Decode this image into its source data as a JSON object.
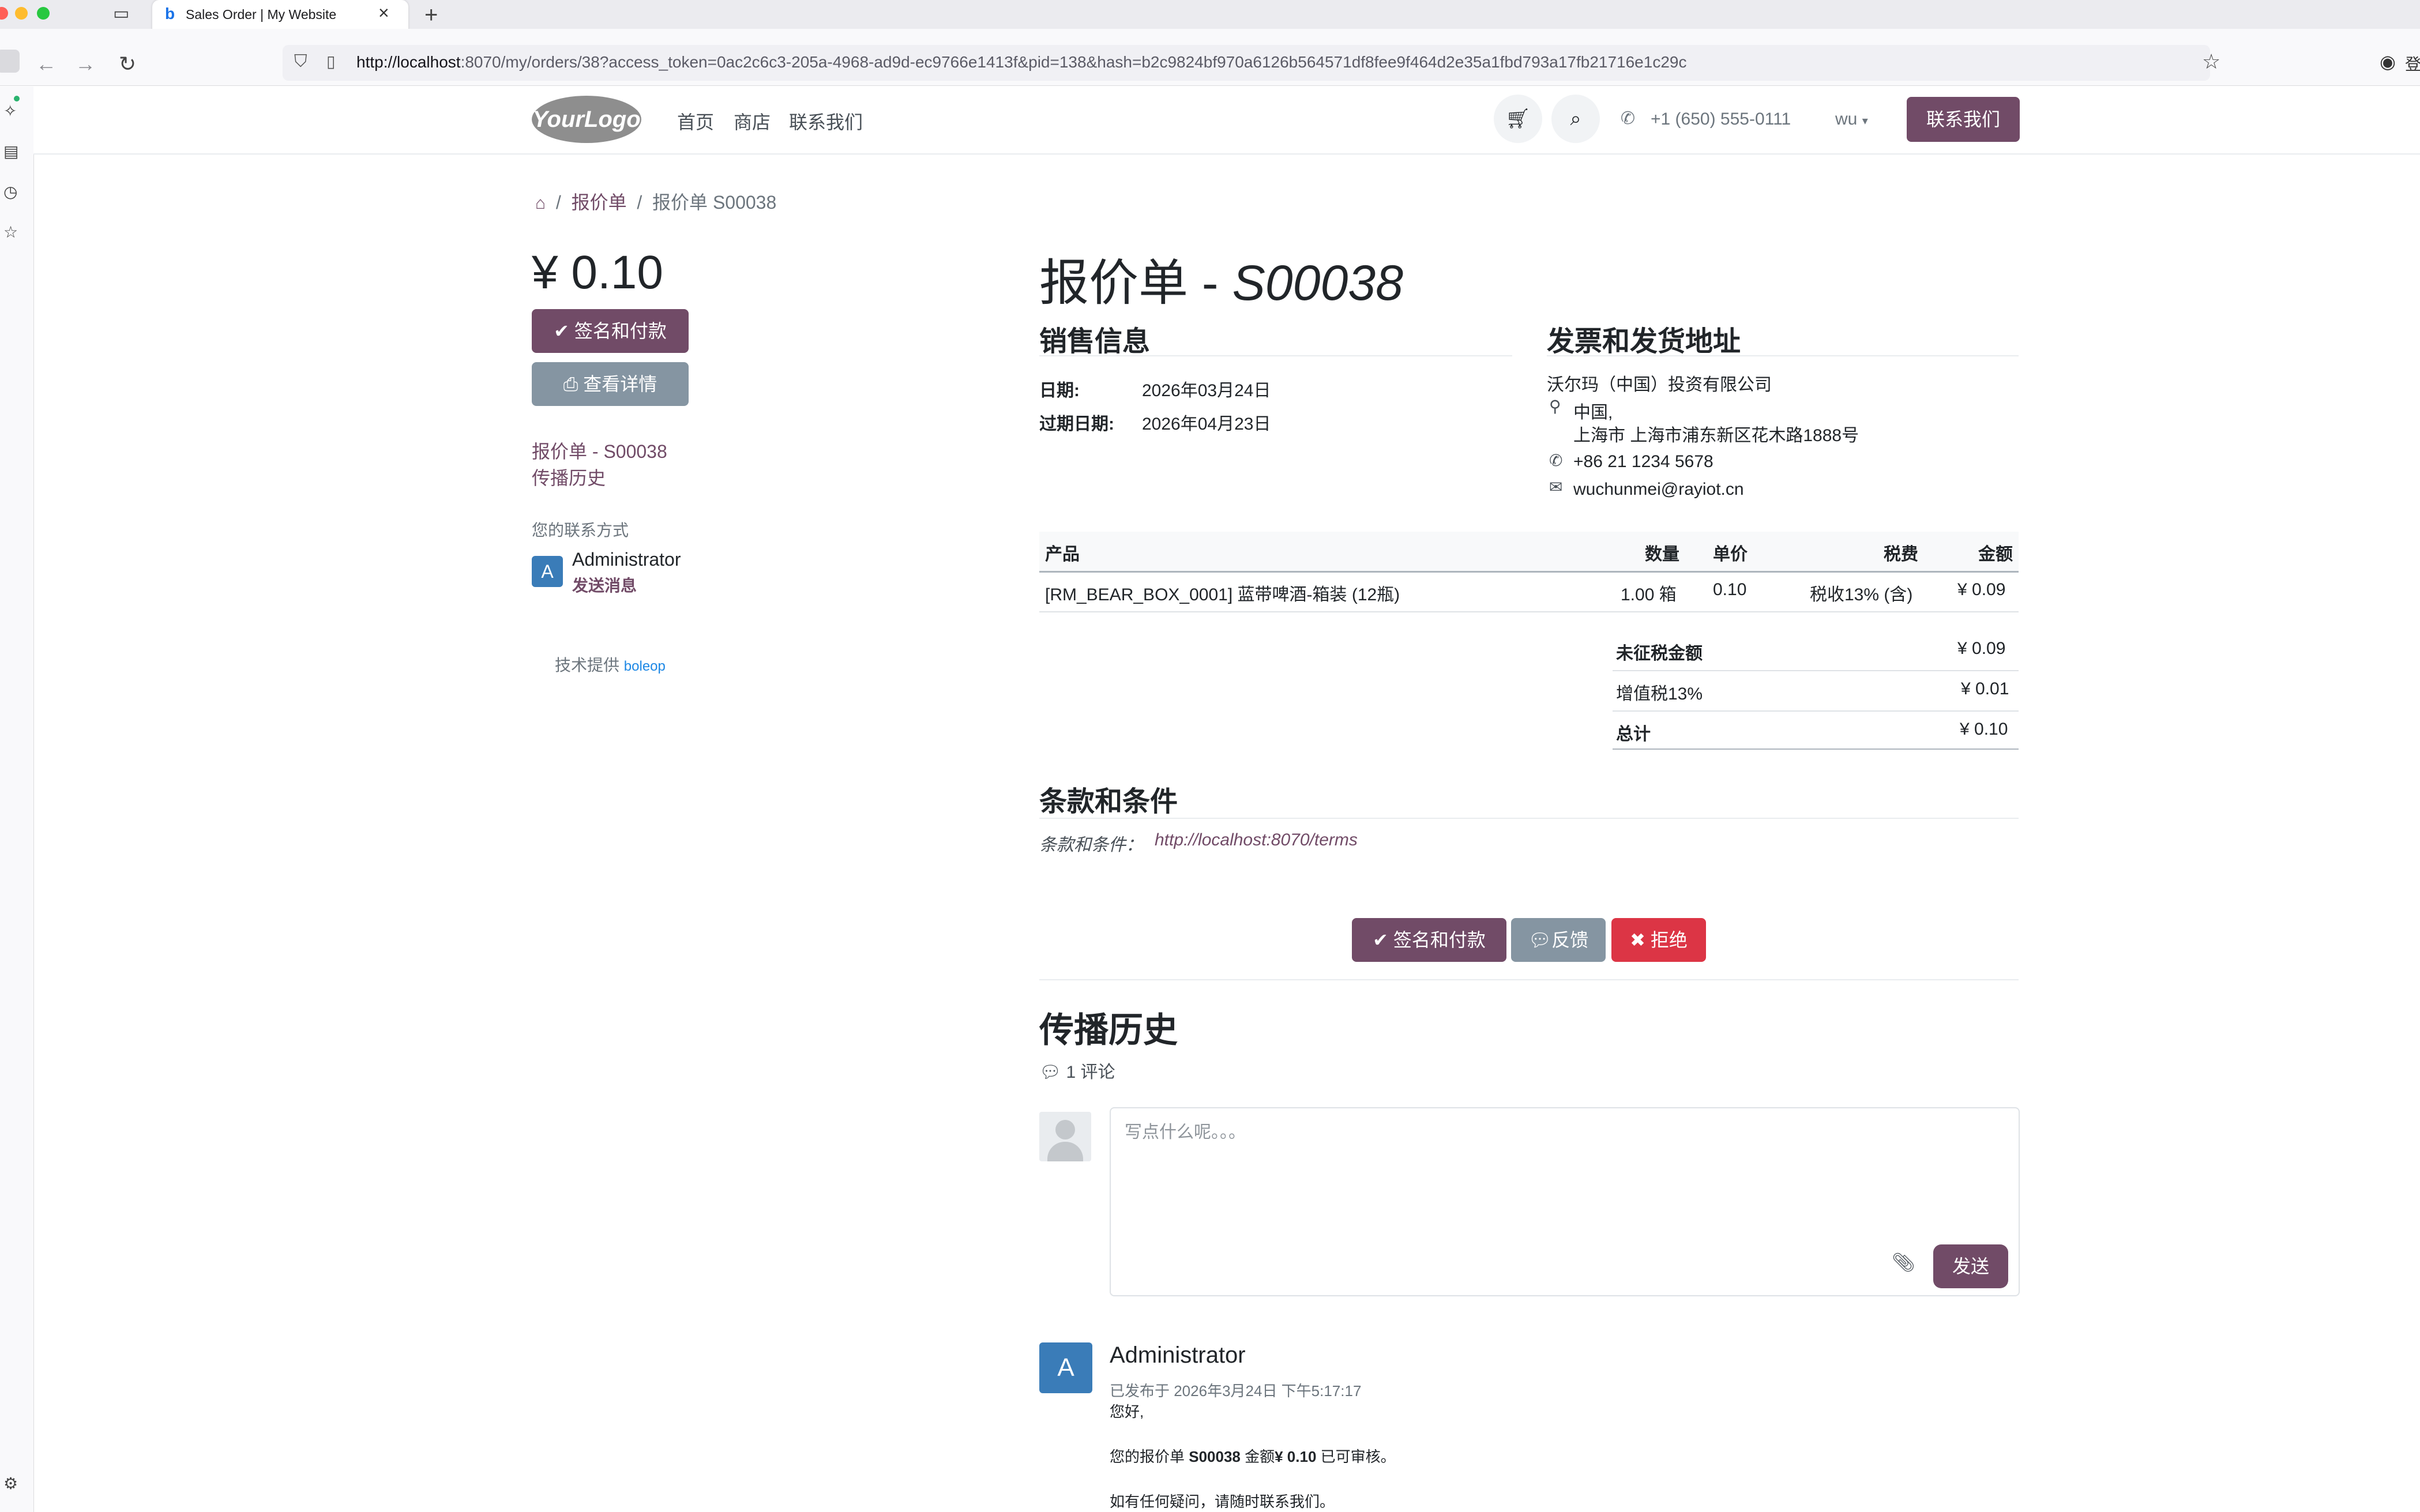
{
  "browser": {
    "tab_title": "Sales Order | My Website",
    "url_host": "http://localhost",
    "url_rest": ":8070/my/orders/38?access_token=0ac2c6c3-205a-4968-ad9d-ec9766e1413f&pid=138&hash=b2c9824bf970a6126b564571df8fee9f464d2e35a1fbd793a17fb21716e1c29c",
    "right_edge_text": "登"
  },
  "header": {
    "logo": "YourLogo",
    "nav": [
      "首页",
      "商店",
      "联系我们"
    ],
    "phone": "+1 (650) 555-0111",
    "user": "wu",
    "contact_button": "联系我们"
  },
  "breadcrumb": {
    "items": [
      "报价单",
      "报价单 S00038"
    ]
  },
  "sidebar_left": {
    "price": "¥ 0.10",
    "sign_pay_button": "签名和付款",
    "view_details_button": "查看详情",
    "nav_links": [
      "报价单 - S00038",
      "传播历史"
    ],
    "contact_label": "您的联系方式",
    "contact_name": "Administrator",
    "contact_avatar": "A",
    "send_message": "发送消息",
    "powered_by": "技术提供",
    "powered_brand": "boleop"
  },
  "main": {
    "title_prefix": "报价单 - ",
    "title_number": "S00038",
    "sales_info": {
      "heading": "销售信息",
      "date_label": "日期:",
      "date_value": "2026年03月24日",
      "expiry_label": "过期日期:",
      "expiry_value": "2026年04月23日"
    },
    "address": {
      "heading": "发票和发货地址",
      "company": "沃尔玛（中国）投资有限公司",
      "country": "中国,",
      "street": "上海市 上海市浦东新区花木路1888号",
      "phone": "+86 21 1234 5678",
      "email": "wuchunmei@rayiot.cn"
    },
    "table": {
      "headers": [
        "产品",
        "数量",
        "单价",
        "税费",
        "金额"
      ],
      "rows": [
        [
          "[RM_BEAR_BOX_0001] 蓝带啤酒-箱装 (12瓶)",
          "1.00 箱",
          "0.10",
          "税收13% (含)",
          "¥ 0.09"
        ]
      ]
    },
    "totals": [
      {
        "label": "未征税金额",
        "value": "¥ 0.09"
      },
      {
        "label": "增值税13%",
        "value": "¥ 0.01"
      },
      {
        "label": "总计",
        "value": "¥ 0.10"
      }
    ],
    "terms": {
      "heading": "条款和条件",
      "label": "条款和条件：",
      "link": "http://localhost:8070/terms"
    },
    "actions": {
      "sign_pay": "签名和付款",
      "feedback": "反馈",
      "reject": "拒绝"
    },
    "history": {
      "heading": "传播历史",
      "comments_count": "1 评论",
      "placeholder": "写点什么呢。。。",
      "send_button": "发送",
      "post_author": "Administrator",
      "post_avatar": "A",
      "post_meta": "已发布于 2026年3月24日 下午5:17:17",
      "post_line1": "您好,",
      "post_line2_a": "您的报价单 ",
      "post_line2_b": "S00038",
      "post_line2_c": " 金额",
      "post_line2_d": "¥ 0.10",
      "post_line2_e": " 已可审核。",
      "post_line3": "如有任何疑问，请随时联系我们。"
    }
  }
}
